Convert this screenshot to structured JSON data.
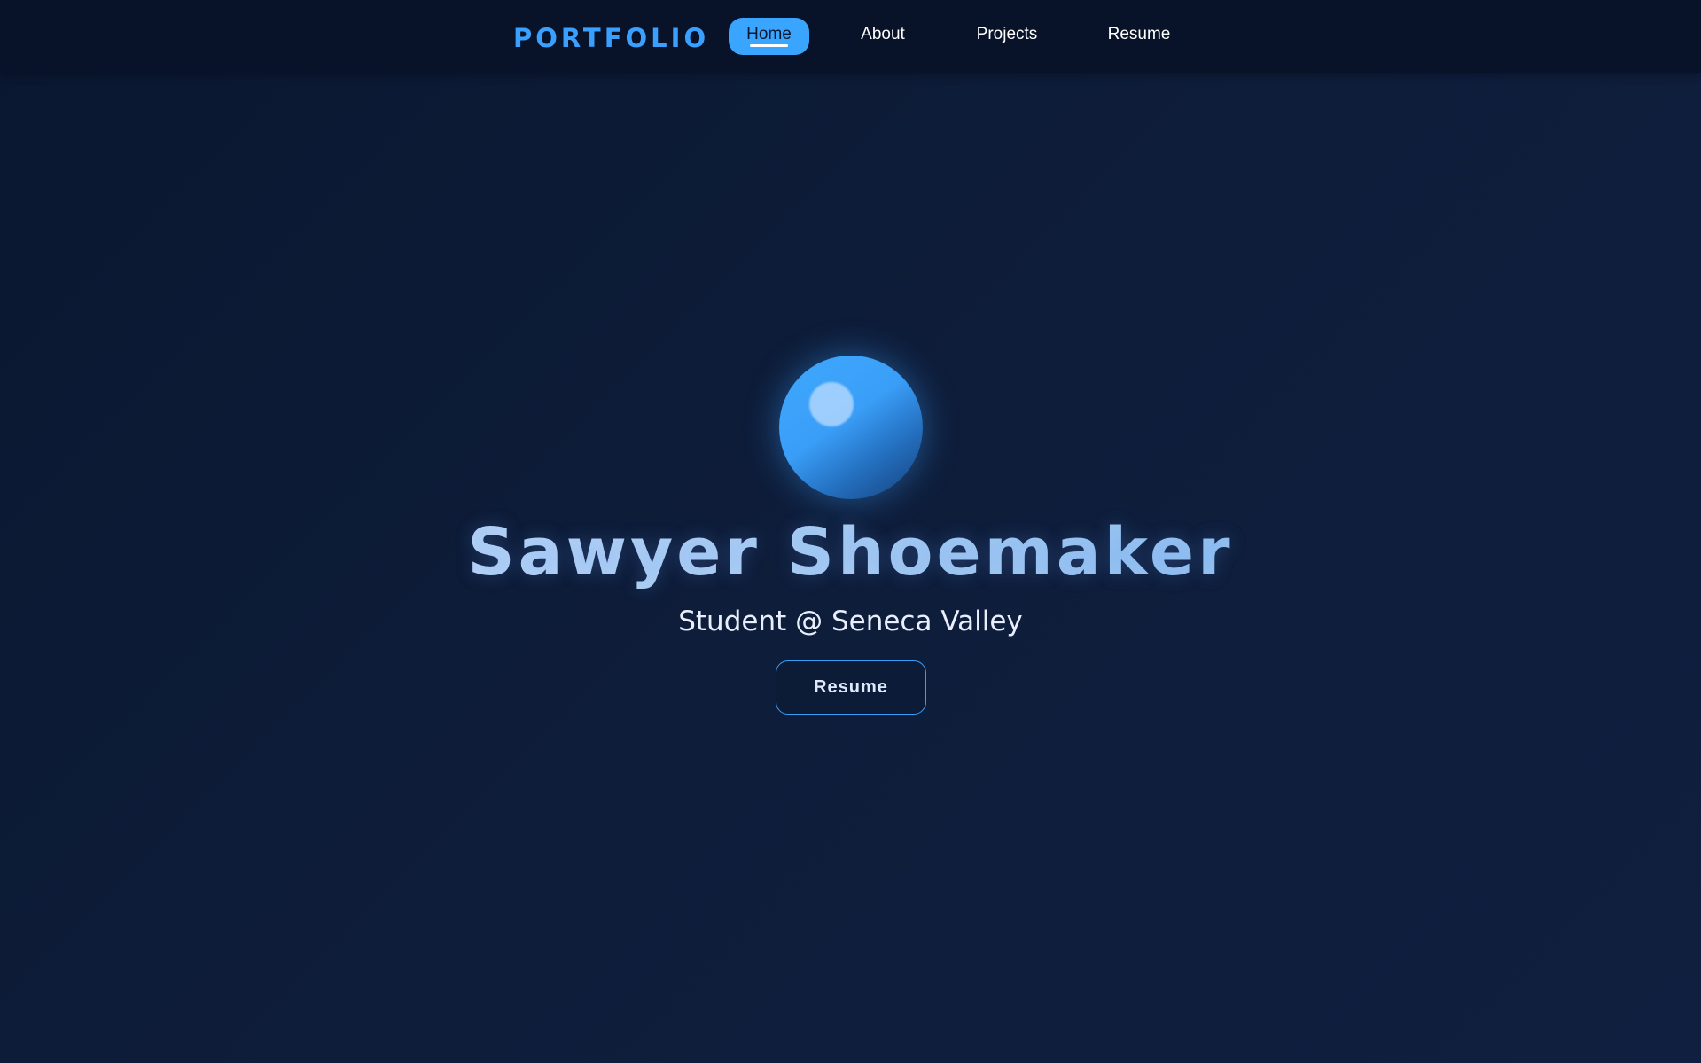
{
  "header": {
    "logo_text": "PORTFOLIO",
    "nav": [
      {
        "label": "Home",
        "active": true
      },
      {
        "label": "About",
        "active": false
      },
      {
        "label": "Projects",
        "active": false
      },
      {
        "label": "Resume",
        "active": false
      }
    ]
  },
  "hero": {
    "name": "Sawyer Shoemaker",
    "subtitle": "Student @ Seneca Valley",
    "button_label": "Resume"
  },
  "colors": {
    "accent": "#3aa5ff",
    "background": "#0e1d3a",
    "header_bg": "#081329"
  }
}
